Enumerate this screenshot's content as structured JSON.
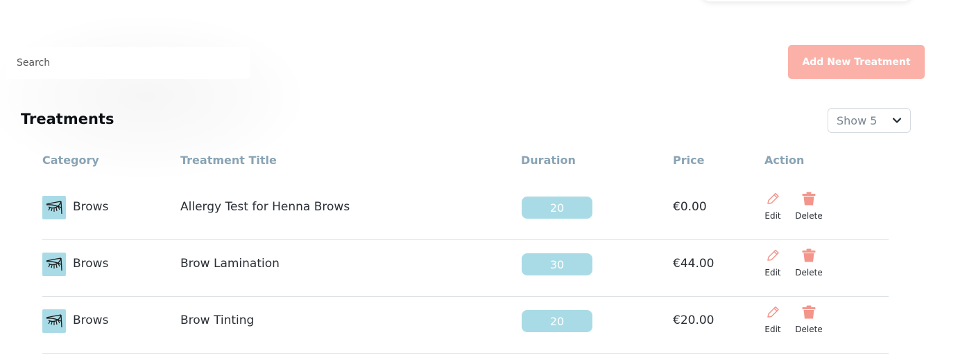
{
  "search": {
    "placeholder": "Search"
  },
  "toolbar": {
    "add_label": "Add New Treatment"
  },
  "page": {
    "title": "Treatments"
  },
  "pagination": {
    "show_label": "Show 5"
  },
  "table": {
    "columns": [
      "Category",
      "Treatment Title",
      "Duration",
      "Price",
      "Action"
    ],
    "rows": [
      {
        "category": "Brows",
        "title": "Allergy Test for Henna Brows",
        "duration": "20",
        "price": "€0.00",
        "edit": "Edit",
        "delete": "Delete"
      },
      {
        "category": "Brows",
        "title": "Brow Lamination",
        "duration": "30",
        "price": "€44.00",
        "edit": "Edit",
        "delete": "Delete"
      },
      {
        "category": "Brows",
        "title": "Brow Tinting",
        "duration": "20",
        "price": "€20.00",
        "edit": "Edit",
        "delete": "Delete"
      }
    ]
  },
  "colors": {
    "accent": "#fbb1a8",
    "pill": "#a9dbe6",
    "header_text": "#89a3b4",
    "icon_action": "#f3958b"
  },
  "icons": {
    "category": "eye-lash-icon",
    "edit": "pencil-icon",
    "delete": "trash-icon",
    "select": "chevron-down-icon"
  }
}
